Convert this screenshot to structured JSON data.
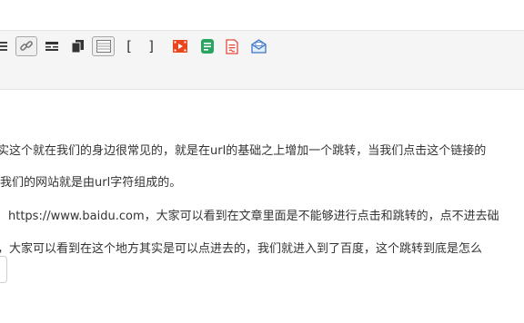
{
  "toolbar": {
    "buttons": [
      {
        "name": "list-icon"
      },
      {
        "name": "link-icon",
        "active": true
      },
      {
        "name": "divider-icon"
      },
      {
        "name": "copy-icon"
      },
      {
        "name": "table-icon",
        "active": true
      },
      {
        "name": "bracket-left-icon",
        "glyph": "["
      },
      {
        "name": "bracket-right-icon",
        "glyph": "]"
      },
      {
        "name": "video-icon"
      },
      {
        "name": "document-green-icon"
      },
      {
        "name": "document-red-icon"
      },
      {
        "name": "mail-icon"
      }
    ],
    "colors": {
      "video": "#e8461c",
      "doc_green": "#2aa561",
      "doc_red": "#e24a3b",
      "mail": "#3c75c8"
    }
  },
  "editor": {
    "lines": [
      "实这个就在我们的身边很常见的，就是在url的基础之上增加一个跳转，当我们点击这个链接的",
      "我们的网站就是由url字符组成的。",
      "https://www.baidu.com，大家可以看到在文章里面是不能够进行点击和跳转的，点不进去础",
      "，大家可以看到在这个地方其实是可以点进去的，我们就进入到了百度，这个跳转到底是怎么"
    ]
  }
}
